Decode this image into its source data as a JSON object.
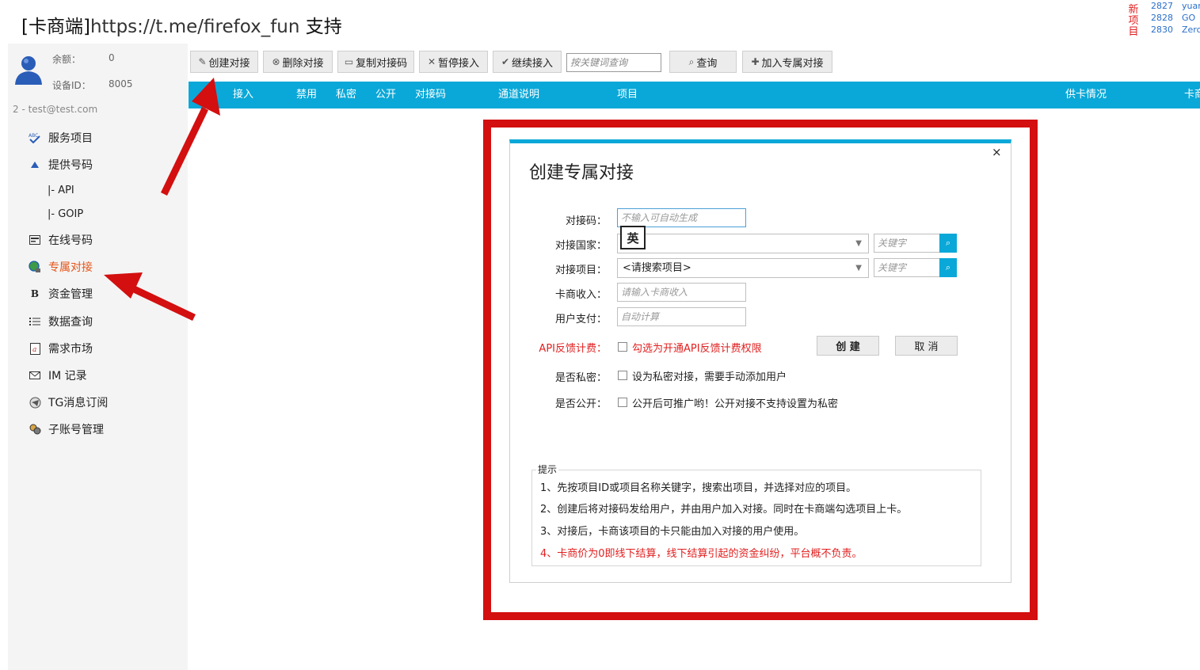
{
  "window": {
    "title_prefix": "[卡商端]",
    "title_url": "https://t.me/firefox_fun",
    "title_suffix": " 支持"
  },
  "news": {
    "tag": "新项目",
    "items": [
      {
        "id": "2827",
        "name": "yuan"
      },
      {
        "id": "2828",
        "name": "GO"
      },
      {
        "id": "2830",
        "name": "Zero"
      }
    ]
  },
  "account": {
    "balance_label": "余额：",
    "balance_value": "0",
    "device_label": "设备ID：",
    "device_value": "8005",
    "email_line": "2 - test@test.com"
  },
  "sidebar": {
    "items": [
      {
        "label": "服务项目",
        "icon": "abc-check-icon"
      },
      {
        "label": "提供号码",
        "icon": "up-arrow-icon"
      },
      {
        "label": "|- API",
        "icon": ""
      },
      {
        "label": "|- GOIP",
        "icon": ""
      },
      {
        "label": "在线号码",
        "icon": "card-icon"
      },
      {
        "label": "专属对接",
        "icon": "globe-icon",
        "active": true
      },
      {
        "label": "资金管理",
        "icon": "bold-b-icon"
      },
      {
        "label": "数据查询",
        "icon": "list-icon"
      },
      {
        "label": "需求市场",
        "icon": "doc-a-icon"
      },
      {
        "label": "IM 记录",
        "icon": "envelope-icon"
      },
      {
        "label": "TG消息订阅",
        "icon": "telegram-icon"
      },
      {
        "label": "子账号管理",
        "icon": "users-icon"
      }
    ]
  },
  "toolbar": {
    "create": "创建对接",
    "delete": "删除对接",
    "copy": "复制对接码",
    "pause": "暂停接入",
    "resume": "继续接入",
    "search_placeholder": "按关键词查询",
    "query": "查询",
    "join": "加入专属对接"
  },
  "table": {
    "columns": [
      "接入",
      "禁用",
      "私密",
      "公开",
      "对接码",
      "通道说明",
      "项目",
      "供卡情况",
      "卡商"
    ]
  },
  "dialog": {
    "title": "创建专属对接",
    "close": "×",
    "code_label": "对接码：",
    "code_placeholder": "不输入可自动生成",
    "country_label": "对接国家：",
    "country_value": "",
    "project_label": "对接项目：",
    "project_value": "<请搜索项目>",
    "keyword_placeholder": "关键字",
    "income_label": "卡商收入：",
    "income_placeholder": "请输入卡商收入",
    "pay_label": "用户支付：",
    "pay_placeholder": "自动计算",
    "api_label": "API反馈计费：",
    "api_text": "勾选为开通API反馈计费权限",
    "private_label": "是否私密：",
    "private_text": "设为私密对接，需要手动添加用户",
    "public_label": "是否公开：",
    "public_text": "公开后可推广哟！公开对接不支持设置为私密",
    "create_button": "创 建",
    "cancel_button": "取 消",
    "ime_indicator": "英"
  },
  "tips": {
    "legend": "提示",
    "lines": [
      "1、先按项目ID或项目名称关键字，搜索出项目，并选择对应的项目。",
      "2、创建后将对接码发给用户，并由用户加入对接。同时在卡商端勾选项目上卡。",
      "3、对接后，卡商该项目的卡只能由加入对接的用户使用。",
      "4、卡商价为0即线下结算，线下结算引起的资金纠纷，平台概不负责。"
    ]
  },
  "colors": {
    "accent": "#0aa8d8",
    "active_menu": "#e4551a",
    "warning_red": "#e02020",
    "highlight_frame": "#d30f0f"
  }
}
